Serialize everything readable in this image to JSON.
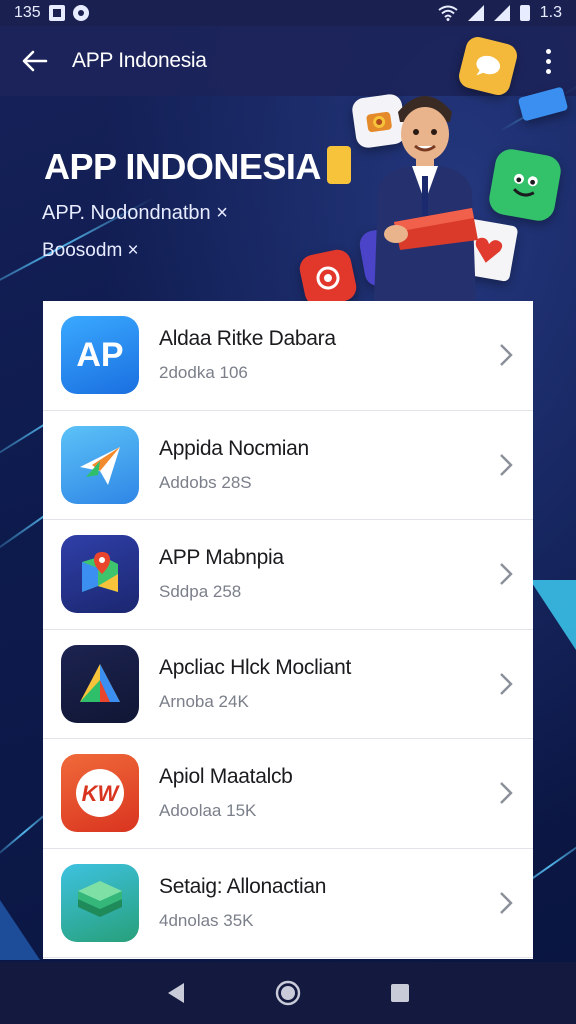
{
  "status_bar": {
    "time": "135",
    "battery_text": "1.3"
  },
  "app_bar": {
    "title": "APP Indonesia",
    "back_icon": "arrow-left-icon",
    "menu_icon": "more-vertical-icon"
  },
  "hero": {
    "title": "APP INDONESIA",
    "subtitle_1": "APP. Nodondnatbn ×",
    "subtitle_2": "Boosodm ×"
  },
  "apps": [
    {
      "name": "Aldaa Ritke Dabara",
      "meta": "2dodka 106",
      "icon": "ap-logo-icon",
      "color": "#1f8ff0"
    },
    {
      "name": "Appida Nocmian",
      "meta": "Addobs 28S",
      "icon": "paper-plane-icon",
      "color": "#3aa6e8"
    },
    {
      "name": "APP Mabnpia",
      "meta": "Sddpa 258",
      "icon": "map-pin-icon",
      "color": "#2b3f9c"
    },
    {
      "name": "Apcliac Hlck Mocliant",
      "meta": "Arnoba 24K",
      "icon": "triangle-logo-icon",
      "color": "#1b2a6e"
    },
    {
      "name": "Apiol Maatalcb",
      "meta": "Adoolaa 15K",
      "icon": "kw-logo-icon",
      "color": "#e8452c"
    },
    {
      "name": "Setaig: Allonactian",
      "meta": "4dnolas 35K",
      "icon": "layers-icon",
      "color": "#2fa98a"
    }
  ],
  "nav": {
    "back": "nav-back-icon",
    "home": "nav-home-icon",
    "recents": "nav-recents-icon"
  },
  "colors": {
    "background": "#0e1a4a",
    "app_bar": "#1c245a",
    "card": "#ffffff",
    "accent_yellow": "#f6c33a"
  }
}
